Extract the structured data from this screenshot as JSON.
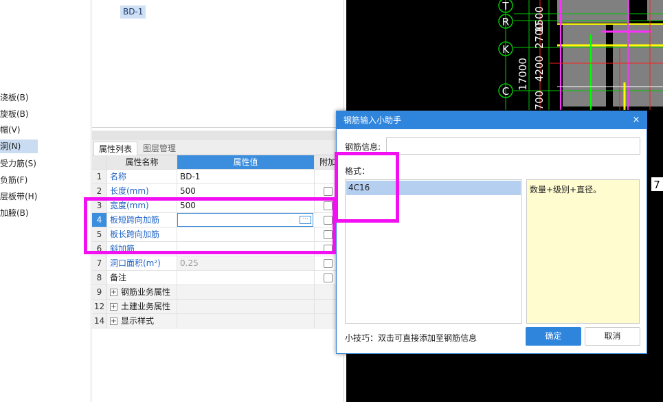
{
  "sidebar": {
    "items": [
      "浇板(B)",
      "旋板(B)",
      "帽(V)",
      "洞(N)",
      "受力筋(S)",
      "负筋(F)",
      "层板带(H)",
      "加腋(B)"
    ],
    "selected_index": 3
  },
  "tree": {
    "node": "BD-1"
  },
  "property_panel": {
    "tabs": [
      "属性列表",
      "图层管理"
    ],
    "active_tab": 0,
    "headers": {
      "name": "属性名称",
      "value": "属性值",
      "add": "附加"
    },
    "rows": [
      {
        "no": "1",
        "name": "名称",
        "value": "BD-1"
      },
      {
        "no": "2",
        "name": "长度(mm)",
        "value": "500"
      },
      {
        "no": "3",
        "name": "宽度(mm)",
        "value": "500"
      },
      {
        "no": "4",
        "name": "板短跨向加筋",
        "value": ""
      },
      {
        "no": "5",
        "name": "板长跨向加筋",
        "value": ""
      },
      {
        "no": "6",
        "name": "斜加筋",
        "value": ""
      },
      {
        "no": "7",
        "name": "洞口面积(m²)",
        "value": "0.25"
      },
      {
        "no": "8",
        "name": "备注",
        "value": ""
      },
      {
        "no": "9",
        "name": "钢筋业务属性",
        "value": ""
      },
      {
        "no": "12",
        "name": "土建业务属性",
        "value": ""
      },
      {
        "no": "14",
        "name": "显示样式",
        "value": ""
      }
    ],
    "edit_button": "···"
  },
  "cad": {
    "axis_labels": [
      "T",
      "R",
      "K",
      "C"
    ],
    "dimensions": [
      "1500",
      "2700",
      "4200",
      "17000",
      "700"
    ],
    "edge_fragment": "7"
  },
  "dialog": {
    "title": "钢筋输入小助手",
    "close": "×",
    "info_label": "钢筋信息:",
    "info_value": "",
    "format_label": "格式：",
    "format_items": [
      "4C16"
    ],
    "format_desc": "数量+级别+直径。",
    "tip": "小技巧：双击可直接添加至钢筋信息",
    "ok": "确定",
    "cancel": "取消"
  },
  "colors": {
    "accent": "#2f84dc",
    "annotation": "#f20ff2",
    "cad_background": "#000000"
  }
}
